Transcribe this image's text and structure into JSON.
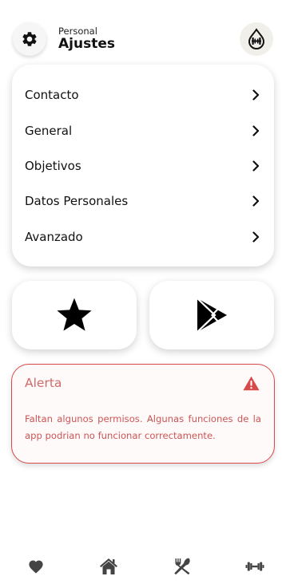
{
  "header": {
    "subtitle": "Personal",
    "title": "Ajustes",
    "settings_icon": "gear-icon",
    "logo_icon": "dumbbell-drop-logo-icon"
  },
  "menu": {
    "items": [
      {
        "label": "Contacto"
      },
      {
        "label": "General"
      },
      {
        "label": "Objetivos"
      },
      {
        "label": "Datos Personales"
      },
      {
        "label": "Avanzado"
      }
    ]
  },
  "actions": {
    "rate_icon": "star-icon",
    "store_icon": "play-store-icon"
  },
  "alert": {
    "title": "Alerta",
    "message": "Faltan algunos permisos. Algunas funciones de la app podrian no funcionar correctamente.",
    "color": "#d84a4a"
  },
  "bottom_nav": {
    "items": [
      {
        "icon": "heart-icon"
      },
      {
        "icon": "home-icon"
      },
      {
        "icon": "utensils-icon"
      },
      {
        "icon": "dumbbell-icon"
      }
    ],
    "color": "#444444"
  }
}
